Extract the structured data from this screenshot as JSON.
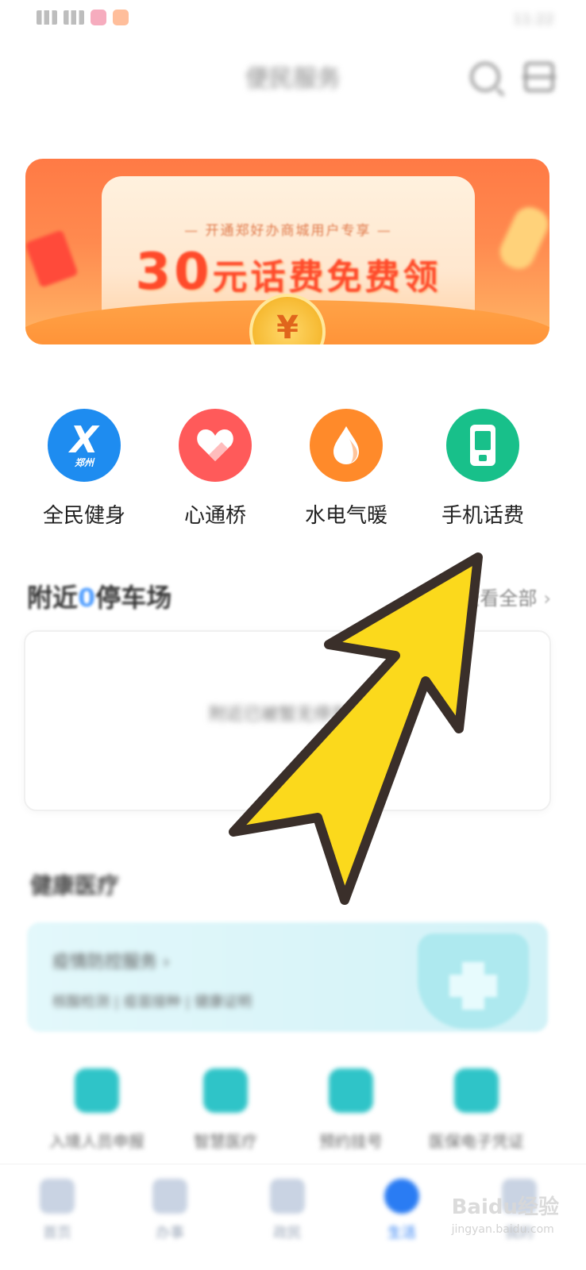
{
  "status_bar": {
    "right_text": "11:22"
  },
  "header": {
    "title": "便民服务"
  },
  "banner": {
    "subtitle": "— 开通郑好办商城用户专享 —",
    "headline_amount": "30",
    "headline_text": "元话费免费领",
    "coin_symbol": "¥"
  },
  "services": [
    {
      "label": "全民健身",
      "icon": "fitness-zhengzhou-icon",
      "color": "#1e8cf0",
      "badge": "郑州"
    },
    {
      "label": "心通桥",
      "icon": "heart-bridge-icon",
      "color": "#ff5a5a"
    },
    {
      "label": "水电气暖",
      "icon": "water-drop-icon",
      "color": "#ff8a2a"
    },
    {
      "label": "手机话费",
      "icon": "mobile-phone-icon",
      "color": "#18c08a"
    }
  ],
  "parking": {
    "title_prefix": "附近",
    "count": "0",
    "title_suffix": "停车场",
    "view_all": "查看全部",
    "empty_text": "附近已被暂无停车场"
  },
  "health": {
    "title": "健康医疗",
    "card_title": "疫情防控服务 ›",
    "card_sub": "核酸检测 | 疫苗接种 | 健康证明"
  },
  "health_services": [
    {
      "label": "入境人员申报"
    },
    {
      "label": "智慧医疗"
    },
    {
      "label": "预约挂号"
    },
    {
      "label": "医保电子凭证"
    }
  ],
  "bottom_nav": [
    {
      "label": "首页"
    },
    {
      "label": "办事"
    },
    {
      "label": "政民"
    },
    {
      "label": "生活",
      "active": true
    },
    {
      "label": "我的"
    }
  ],
  "watermark": {
    "brand": "Baidu经验",
    "url": "jingyan.baidu.com"
  },
  "colors": {
    "arrow_fill": "#fbd91c",
    "arrow_stroke": "#3a2f2a",
    "accent_blue": "#2a7cf3"
  }
}
